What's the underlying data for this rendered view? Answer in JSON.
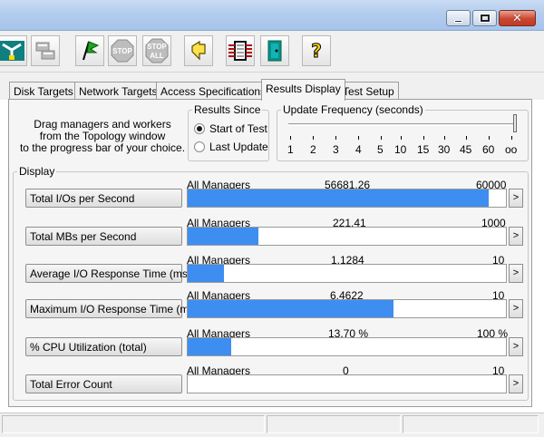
{
  "toolbar": {
    "buttons": [
      "topology-icon",
      "disk-workers-icon",
      "start-flag-icon",
      "stop-icon",
      "stop-all-icon",
      "reset-icon",
      "copy-worker-icon",
      "exit-icon",
      "help-icon"
    ],
    "stop_label": "STOP",
    "stop_all_label": "STOP",
    "stop_all_sub": "ALL"
  },
  "tabs": [
    {
      "label": "Disk Targets"
    },
    {
      "label": "Network Targets"
    },
    {
      "label": "Access Specifications"
    },
    {
      "label": "Results Display",
      "active": true
    },
    {
      "label": "Test Setup"
    }
  ],
  "drag_help": [
    "Drag managers and workers",
    "from the Topology window",
    "to the progress bar of your choice."
  ],
  "results_since": {
    "legend": "Results Since",
    "options": [
      "Start of Test",
      "Last Update"
    ],
    "selected": "Start of Test"
  },
  "update_frequency": {
    "legend": "Update Frequency (seconds)",
    "ticks": [
      "1",
      "2",
      "3",
      "4",
      "5",
      "10",
      "15",
      "30",
      "45",
      "60",
      "oo"
    ],
    "selected": "oo"
  },
  "display": {
    "legend": "Display",
    "rows": [
      {
        "label": "Total I/Os per Second",
        "source": "All Managers",
        "value": "56681.26",
        "max": "60000",
        "fraction": 0.9447
      },
      {
        "label": "Total MBs per Second",
        "source": "All Managers",
        "value": "221.41",
        "max": "1000",
        "fraction": 0.2214
      },
      {
        "label": "Average I/O Response Time (ms)",
        "source": "All Managers",
        "value": "1.1284",
        "max": "10",
        "fraction": 0.1128
      },
      {
        "label": "Maximum I/O Response Time (ms)",
        "source": "All Managers",
        "value": "6.4622",
        "max": "10",
        "fraction": 0.6462
      },
      {
        "label": "% CPU Utilization (total)",
        "source": "All Managers",
        "value": "13.70 %",
        "max": "100 %",
        "fraction": 0.137
      },
      {
        "label": "Total Error Count",
        "source": "All Managers",
        "value": "0",
        "max": "10",
        "fraction": 0
      }
    ],
    "more_label": ">"
  },
  "colors": {
    "bar": "#3d8ef0",
    "titlebar": "#b3cdee",
    "close": "#c9462f"
  }
}
